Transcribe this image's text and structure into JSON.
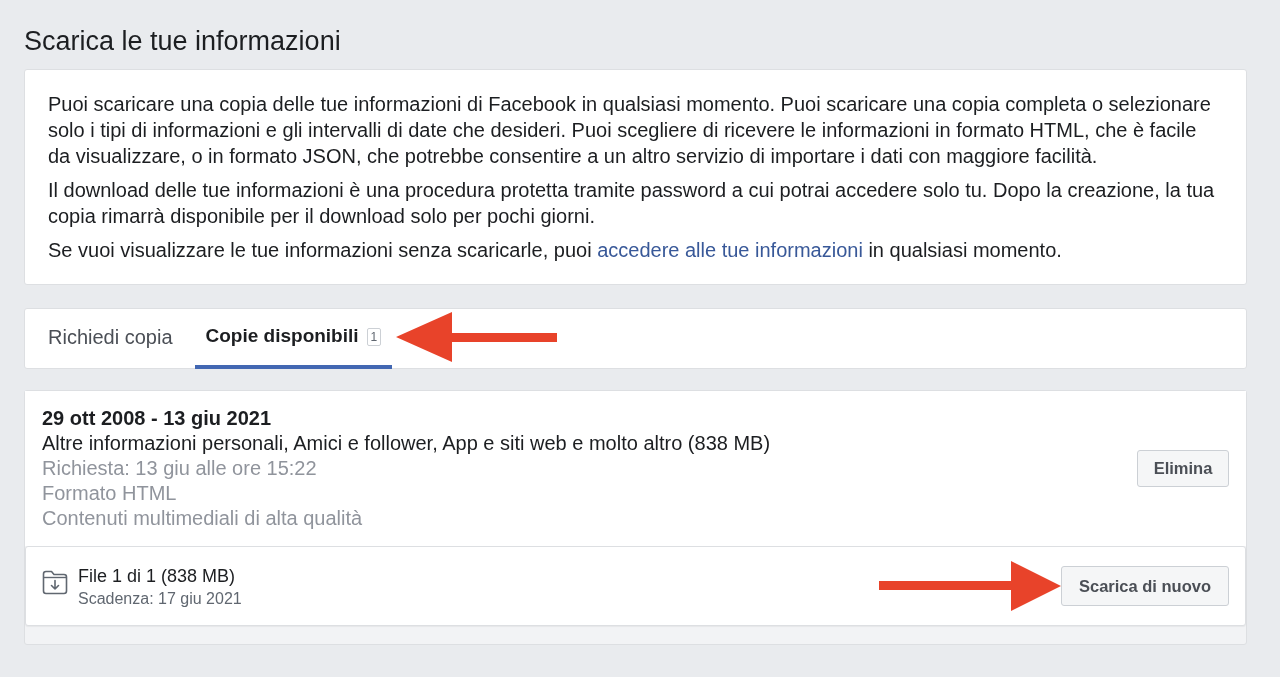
{
  "page_title": "Scarica le tue informazioni",
  "intro": {
    "paragraphs": [
      "Puoi scaricare una copia delle tue informazioni di Facebook in qualsiasi momento. Puoi scaricare una copia completa o selezionare solo i tipi di informazioni e gli intervalli di date che desideri. Puoi scegliere di ricevere le informazioni in formato HTML, che è facile da visualizzare, o in formato JSON, che potrebbe consentire a un altro servizio di importare i dati con maggiore facilità.",
      "Il download delle tue informazioni è una procedura protetta tramite password a cui potrai accedere solo tu. Dopo la creazione, la tua copia rimarrà disponibile per il download solo per pochi giorni."
    ],
    "link_paragraph": {
      "before": "Se vuoi visualizzare le tue informazioni senza scaricarle, puoi",
      "link": "accedere alle tue informazioni",
      "after": "in qualsiasi momento."
    }
  },
  "tabs": [
    {
      "label": "Richiedi copia",
      "selected": false
    },
    {
      "label": "Copie disponibili",
      "selected": true,
      "count": "1"
    }
  ],
  "copies": [
    {
      "date_range": "29 ott 2008 - 13 giu 2021",
      "description": "Altre informazioni personali, Amici e follower, App e siti web e molto altro (838 MB)",
      "details": [
        "Richiesta: 13 giu alle ore 15:22",
        "Formato HTML",
        "Contenuti multimediali di alta qualità"
      ],
      "delete_button": "Elimina",
      "files": [
        {
          "name": "File 1 di 1 (838 MB)",
          "expiry": "Scadenza: 17 giu 2021",
          "button": "Scarica di nuovo"
        }
      ]
    }
  ]
}
